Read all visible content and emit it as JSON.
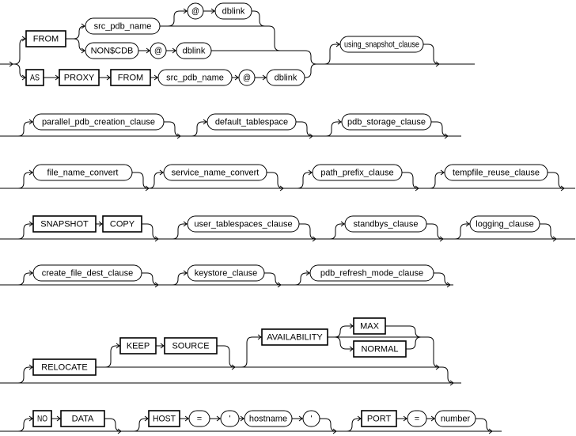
{
  "rows": {
    "source": {
      "from": "FROM",
      "src_pdb_name": "src_pdb_name",
      "at": "@",
      "dblink": "dblink",
      "non_cdb": "NON$CDB",
      "as": "AS",
      "proxy": "PROXY",
      "using_snapshot_clause": "using_snapshot_clause"
    },
    "creation": {
      "parallel_pdb_creation_clause": "parallel_pdb_creation_clause",
      "default_tablespace": "default_tablespace",
      "pdb_storage_clause": "pdb_storage_clause"
    },
    "convert": {
      "file_name_convert": "file_name_convert",
      "service_name_convert": "service_name_convert",
      "path_prefix_clause": "path_prefix_clause",
      "tempfile_reuse_clause": "tempfile_reuse_clause"
    },
    "snapshot": {
      "snapshot": "SNAPSHOT",
      "copy": "COPY",
      "user_tablespaces_clause": "user_tablespaces_clause",
      "standbys_clause": "standbys_clause",
      "logging_clause": "logging_clause"
    },
    "dest": {
      "create_file_dest_clause": "create_file_dest_clause",
      "keystore_clause": "keystore_clause",
      "pdb_refresh_mode_clause": "pdb_refresh_mode_clause"
    },
    "relocate": {
      "relocate": "RELOCATE",
      "keep": "KEEP",
      "source": "SOURCE",
      "availability": "AVAILABILITY",
      "max": "MAX",
      "normal": "NORMAL"
    },
    "host": {
      "no": "NO",
      "data": "DATA",
      "host": "HOST",
      "equals": "=",
      "quote": "'",
      "hostname": "hostname",
      "port": "PORT",
      "number": "number"
    }
  }
}
